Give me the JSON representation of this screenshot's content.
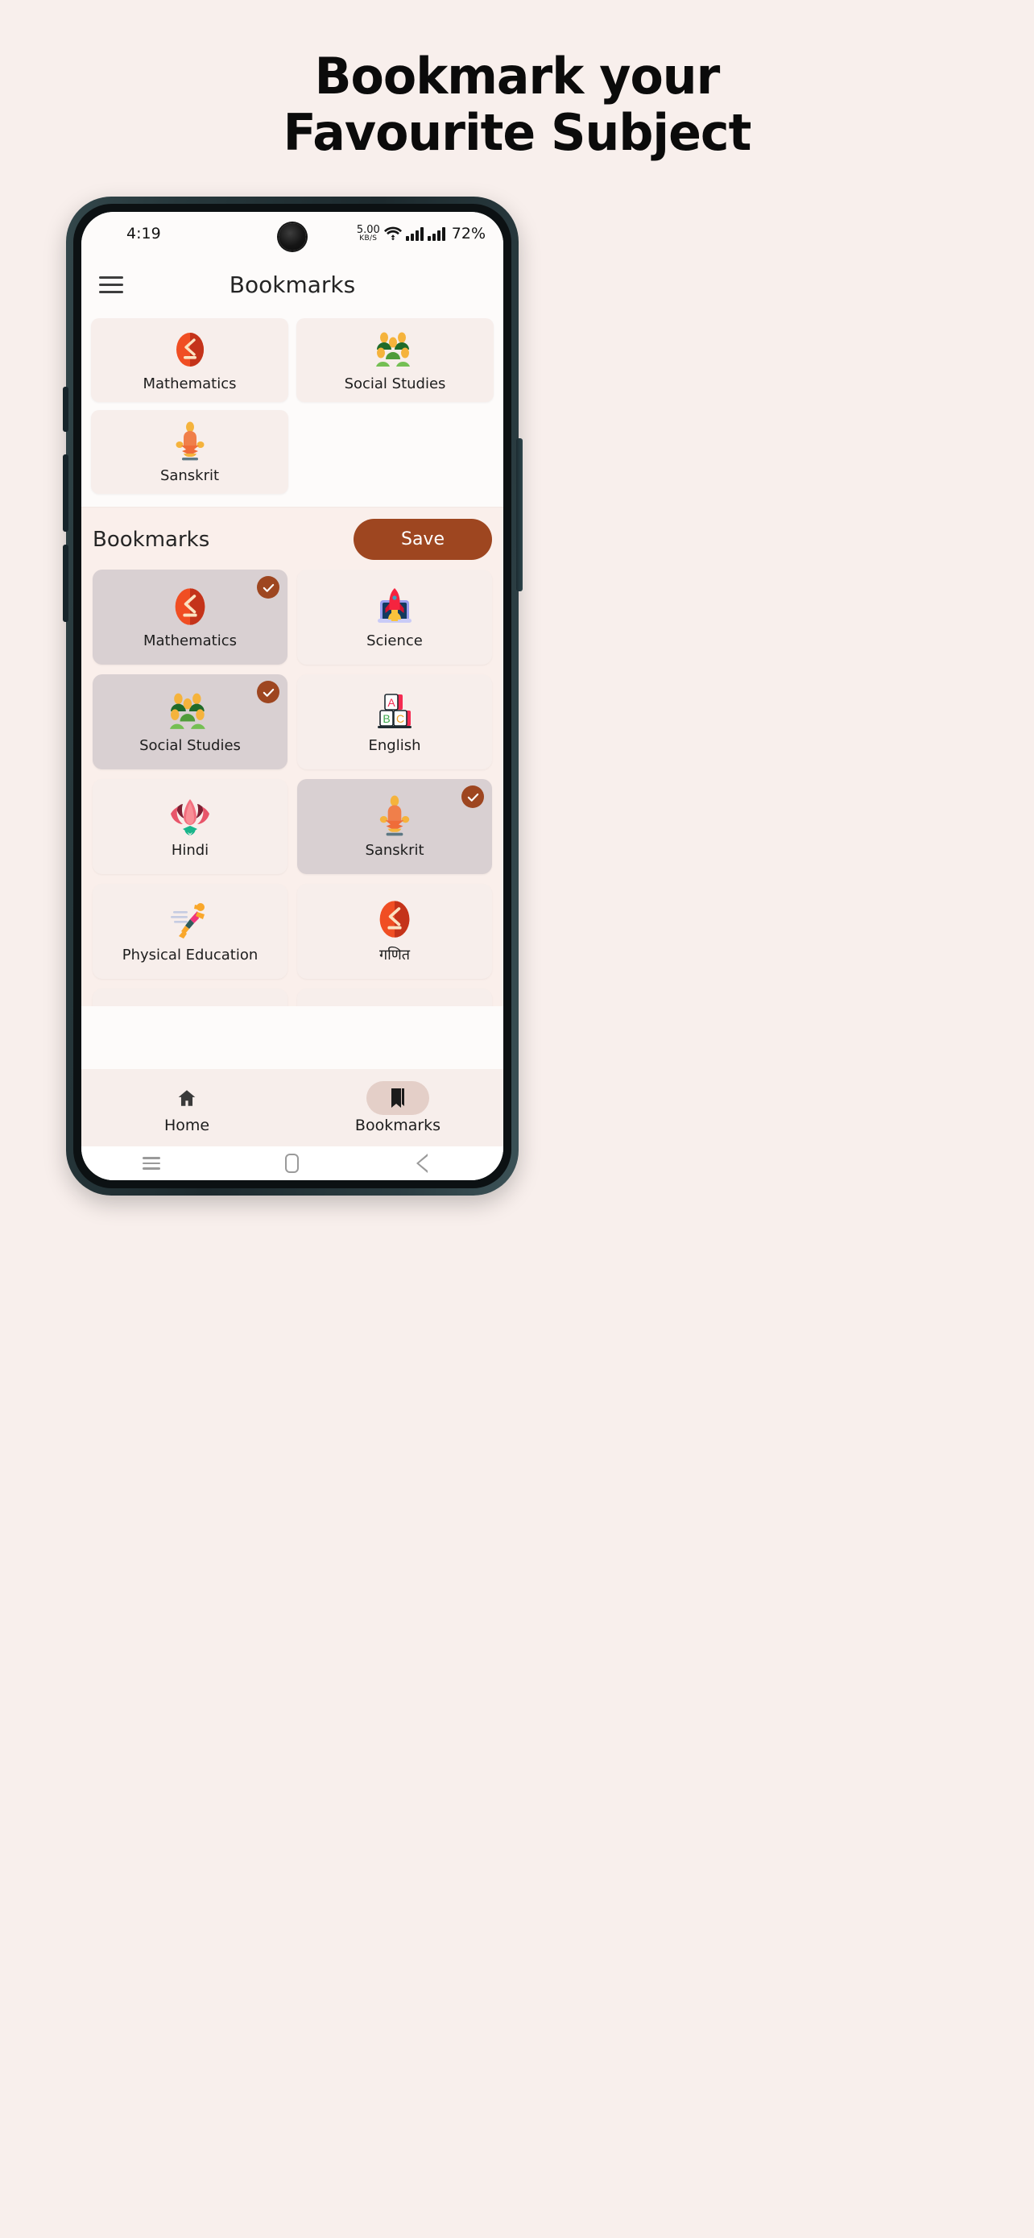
{
  "promo": {
    "line1": "Bookmark your",
    "line2": "Favourite Subject"
  },
  "status_bar": {
    "time": "4:19",
    "net_speed_value": "5.00",
    "net_speed_unit": "KB/S",
    "battery": "72%",
    "wifi_icon": "wifi-icon",
    "signal_icon": "signal-bars-icon"
  },
  "app_bar": {
    "menu_icon": "hamburger-menu-icon",
    "title": "Bookmarks"
  },
  "saved_bookmarks": [
    {
      "label": "Mathematics",
      "icon": "math-less-equal-icon"
    },
    {
      "label": "Social Studies",
      "icon": "people-group-icon"
    },
    {
      "label": "Sanskrit",
      "icon": "meditation-icon"
    }
  ],
  "section": {
    "title": "Bookmarks",
    "save_label": "Save"
  },
  "chooser": [
    {
      "label": "Mathematics",
      "icon": "math-less-equal-icon",
      "selected": true
    },
    {
      "label": "Science",
      "icon": "rocket-icon",
      "selected": false
    },
    {
      "label": "Social Studies",
      "icon": "people-group-icon",
      "selected": true
    },
    {
      "label": "English",
      "icon": "abc-blocks-icon",
      "selected": false
    },
    {
      "label": "Hindi",
      "icon": "lotus-icon",
      "selected": false
    },
    {
      "label": "Sanskrit",
      "icon": "meditation-icon",
      "selected": true
    },
    {
      "label": "Physical Education",
      "icon": "running-person-icon",
      "selected": false
    },
    {
      "label": "गणित",
      "icon": "math-less-equal-icon",
      "selected": false
    },
    {
      "label": "",
      "icon": "rocket-icon",
      "selected": false
    },
    {
      "label": "",
      "icon": "people-group-icon",
      "selected": false
    }
  ],
  "bottom_nav": [
    {
      "label": "Home",
      "icon": "home-icon",
      "active": false
    },
    {
      "label": "Bookmarks",
      "icon": "bookmark-icon",
      "active": true
    }
  ],
  "system_nav": {
    "recents_icon": "recents-icon",
    "home_icon": "home-square-icon",
    "back_icon": "back-triangle-icon"
  },
  "colors": {
    "page_bg": "#f8efec",
    "accent": "#9e4620",
    "card_bg": "#f7eeeb",
    "card_selected_bg": "#d9d0d2",
    "section_bg": "#faefeb",
    "screen_bg": "#fdfbfa",
    "nav_pill": "#e4cfc8"
  }
}
